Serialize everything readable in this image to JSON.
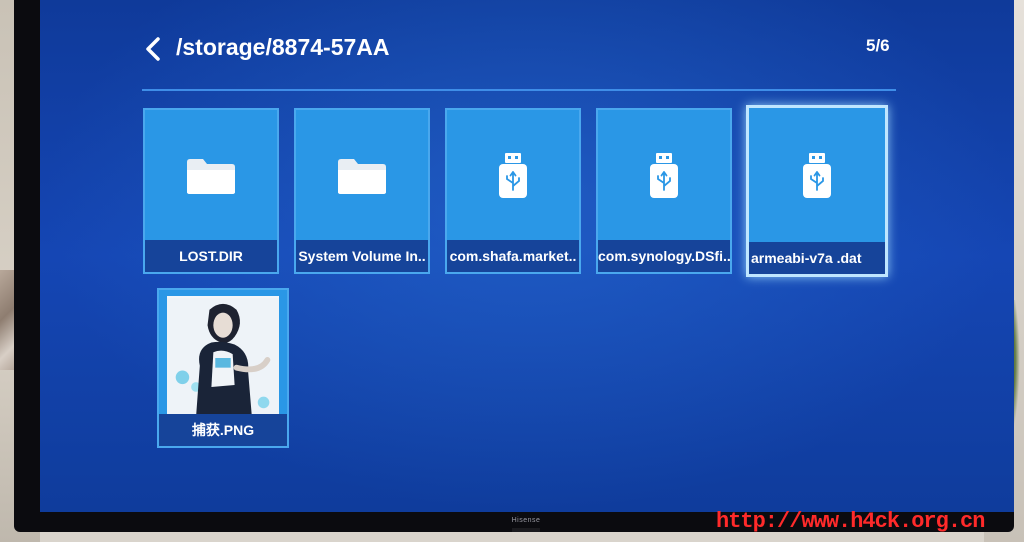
{
  "header": {
    "path": "/storage/8874-57AA",
    "page_indicator": "5/6"
  },
  "tv": {
    "brand": "Hisense"
  },
  "files": [
    {
      "label": "LOST.DIR",
      "icon": "folder-icon"
    },
    {
      "label": "System Volume In..",
      "icon": "folder-icon"
    },
    {
      "label": "com.shafa.market..",
      "icon": "usb-icon"
    },
    {
      "label": "com.synology.DSfi..",
      "icon": "usb-icon"
    },
    {
      "label": "armeabi-v7a .dat",
      "icon": "usb-icon",
      "selected": true
    },
    {
      "label": "捕获.PNG",
      "icon": "image-thumbnail"
    }
  ],
  "watermark": "http://www.h4ck.org.cn",
  "colors": {
    "screen_bg": "#1546b4",
    "tile_bg": "#2a97e6",
    "label_bg": "#16449a",
    "accent_rule": "#3f8ee8",
    "watermark": "#ff2a2a"
  }
}
